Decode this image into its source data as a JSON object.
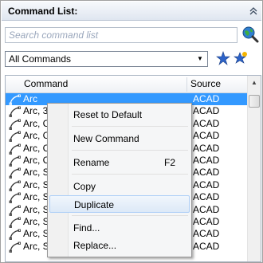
{
  "panel": {
    "title": "Command List:",
    "search_placeholder": "Search command list",
    "filter_value": "All Commands"
  },
  "list": {
    "columns": [
      "Command",
      "Source"
    ],
    "rows": [
      {
        "name": "Arc",
        "source": "ACAD",
        "selected": true
      },
      {
        "name": "Arc, 3",
        "source": "ACAD"
      },
      {
        "name": "Arc, C",
        "source": "ACAD"
      },
      {
        "name": "Arc, C",
        "source": "ACAD"
      },
      {
        "name": "Arc, C",
        "source": "ACAD"
      },
      {
        "name": "Arc, C",
        "source": "ACAD"
      },
      {
        "name": "Arc, S",
        "source": "ACAD"
      },
      {
        "name": "Arc, S",
        "source": "ACAD"
      },
      {
        "name": "Arc, S",
        "source": "ACAD"
      },
      {
        "name": "Arc, S",
        "source": "ACAD"
      },
      {
        "name": "Arc, S",
        "source": "ACAD"
      },
      {
        "name": "Arc, S",
        "source": "ACAD"
      },
      {
        "name": "Arc, S",
        "source": "ACAD"
      }
    ]
  },
  "context_menu": {
    "items": [
      {
        "label": "Reset to Default",
        "shortcut": ""
      },
      {
        "label": "New Command",
        "shortcut": ""
      },
      {
        "label": "Rename",
        "shortcut": "F2"
      },
      {
        "label": "Copy",
        "shortcut": ""
      },
      {
        "label": "Duplicate",
        "shortcut": "",
        "hover": true
      },
      {
        "label": "Find...",
        "shortcut": ""
      },
      {
        "label": "Replace...",
        "shortcut": ""
      }
    ]
  },
  "colors": {
    "selection": "#3399ff",
    "hover_border": "#aecff7"
  },
  "icons": {
    "search": "globe-search-icon",
    "star_add": "star-add-icon",
    "star_filter": "star-icon",
    "row": "arc-icon"
  }
}
